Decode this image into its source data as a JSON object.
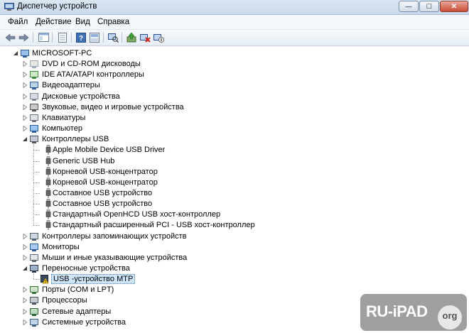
{
  "window": {
    "title": "Диспетчер устройств",
    "minimize_glyph": "—",
    "maximize_glyph": "□",
    "close_glyph": "✕"
  },
  "menu": {
    "file": "Файл",
    "action": "Действие",
    "view": "Вид",
    "help": "Справка"
  },
  "toolbar": {
    "buttons": [
      "back-arrow-icon",
      "forward-arrow-icon",
      "show-hide-tree-icon",
      "properties-icon",
      "help-icon",
      "help-alt-icon",
      "scan-hardware-icon",
      "update-driver-icon",
      "uninstall-icon",
      "disable-device-icon"
    ]
  },
  "tree": {
    "root": "MICROSOFT-PC",
    "items": [
      {
        "label": "DVD и CD-ROM дисководы",
        "icon": "dvd-drive-icon",
        "expanded": false
      },
      {
        "label": "IDE ATA/ATAPI контроллеры",
        "icon": "ide-controller-icon",
        "expanded": false
      },
      {
        "label": "Видеоадаптеры",
        "icon": "video-adapter-icon",
        "expanded": false
      },
      {
        "label": "Дисковые устройства",
        "icon": "disk-drive-icon",
        "expanded": false
      },
      {
        "label": "Звуковые, видео и игровые устройства",
        "icon": "sound-icon",
        "expanded": false
      },
      {
        "label": "Клавиатуры",
        "icon": "keyboard-icon",
        "expanded": false
      },
      {
        "label": "Компьютер",
        "icon": "computer-icon",
        "expanded": false
      },
      {
        "label": "Контроллеры USB",
        "icon": "usb-controller-icon",
        "expanded": true,
        "children": [
          "Apple Mobile Device USB Driver",
          "Generic USB Hub",
          "Корневой USB-концентратор",
          "Корневой USB-концентратор",
          "Составное USB устройство",
          "Составное USB устройство",
          "Стандартный OpenHCD USB хост-контроллер",
          "Стандартный расширенный PCI - USB хост-контроллер"
        ]
      },
      {
        "label": "Контроллеры запоминающих устройств",
        "icon": "storage-controller-icon",
        "expanded": false
      },
      {
        "label": "Мониторы",
        "icon": "monitor-icon",
        "expanded": false
      },
      {
        "label": "Мыши и иные указывающие устройства",
        "icon": "mouse-icon",
        "expanded": false
      },
      {
        "label": "Переносные устройства",
        "icon": "portable-device-icon",
        "expanded": true,
        "children": [
          "USB -устройство MTP"
        ]
      },
      {
        "label": "Порты (COM и LPT)",
        "icon": "port-icon",
        "expanded": false
      },
      {
        "label": "Процессоры",
        "icon": "processor-icon",
        "expanded": false
      },
      {
        "label": "Сетевые адаптеры",
        "icon": "network-adapter-icon",
        "expanded": false
      },
      {
        "label": "Системные устройства",
        "icon": "system-device-icon",
        "expanded": false
      }
    ]
  },
  "watermark": {
    "text": "RU-iPAD",
    "suffix": "org"
  }
}
